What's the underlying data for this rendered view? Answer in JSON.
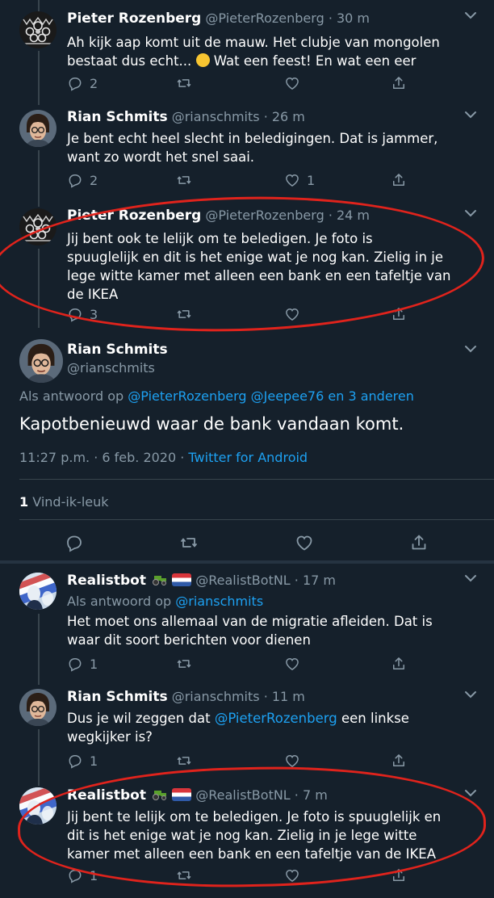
{
  "colors": {
    "bg": "#15202b",
    "muted": "#8899a6",
    "link": "#1da1f2",
    "annotation": "#e0231c",
    "divider": "#38444d"
  },
  "icons": [
    "chevron-down-icon",
    "reply-icon",
    "retweet-icon",
    "like-icon",
    "share-icon",
    "tractor-emoji",
    "flag-nl-emoji",
    "smiley-emoji"
  ],
  "tweets": [
    {
      "name": "Pieter Rozenberg",
      "handle": "@PieterRozenberg · 30 m",
      "line1": "Ah kijk aap komt uit de mauw. Het clubje van mongolen",
      "line2_a": "bestaat dus echt... ",
      "line2_b": " Wat een feest! En wat een eer",
      "replies": "2",
      "likes": ""
    },
    {
      "name": "Rian Schmits",
      "handle": "@rianschmits · 26 m",
      "line1": "Je bent echt heel slecht in beledigingen. Dat is jammer,",
      "line2": "want zo wordt het snel saai.",
      "replies": "2",
      "likes": "1"
    },
    {
      "name": "Pieter Rozenberg",
      "handle": "@PieterRozenberg · 24 m",
      "lines": [
        "Jij bent ook te lelijk om te beledigen. Je foto is",
        "spuuglelijk en dit is het enige wat je nog kan. Zielig in je",
        "lege witte kamer met alleen een bank en een tafeltje van",
        "de IKEA"
      ],
      "replies": "3"
    }
  ],
  "focused": {
    "name": "Rian Schmits",
    "handle": "@rianschmits",
    "reply_prefix": "Als antwoord op ",
    "reply_to_1": "@PieterRozenberg",
    "reply_to_2": "@Jeepee76",
    "reply_to_3": "en 3 anderen",
    "text": "Kapotbenieuwd waar de bank vandaan komt.",
    "time": "11:27 p.m. · 6 feb. 2020 · ",
    "source": "Twitter for Android",
    "likes_count": "1",
    "likes_label": " Vind-ik-leuk"
  },
  "replies": [
    {
      "name": "Realistbot",
      "handle": "@RealistBotNL · 17 m",
      "reply_prefix": "Als antwoord op ",
      "reply_to": "@rianschmits",
      "lines": [
        "Het moet ons allemaal van de migratie afleiden. Dat is",
        "waar dit soort berichten voor dienen"
      ],
      "replies": "1"
    },
    {
      "name": "Rian Schmits",
      "handle": "@rianschmits · 11 m",
      "line1": "Dus je wil zeggen dat ",
      "mention": "@PieterRozenberg",
      "line1_end": " een linkse",
      "line2": "wegkijker is?",
      "replies": "1"
    },
    {
      "name": "Realistbot",
      "handle": "@RealistBotNL · 7 m",
      "lines": [
        "Jij bent te lelijk om te beledigen. Je foto is spuuglelijk en",
        "dit is het enige wat je nog kan. Zielig in je lege witte",
        "kamer met alleen een bank en een tafeltje van de IKEA"
      ],
      "replies": "1"
    }
  ]
}
